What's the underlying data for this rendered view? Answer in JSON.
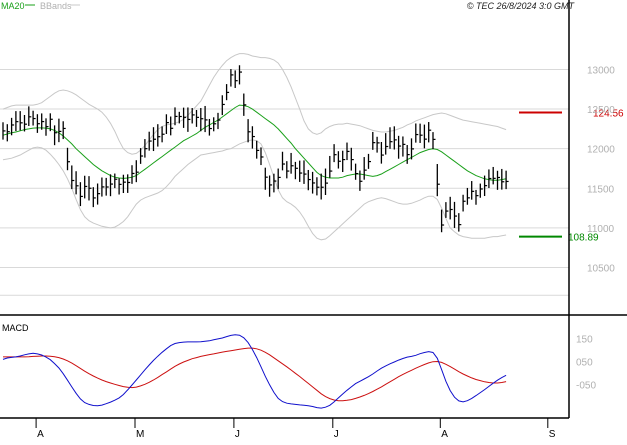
{
  "header": {
    "ma_label": "MA20",
    "bb_label": "BBands",
    "copyright": "© TEC 26/8/2024 3:0 GMT"
  },
  "colors": {
    "ma": "#1aa01a",
    "bands": "#c8c8c8",
    "price": "#000000",
    "grid": "#d9d9d9",
    "resistance": "#cc0000",
    "support": "#008800",
    "macd": "#1010cc",
    "signal": "#cc1010",
    "axis": "#000000",
    "ticklabel": "#b0b0b0"
  },
  "macd_panel": {
    "title": "MACD"
  },
  "levels": {
    "resistance": {
      "value": 12456,
      "label": "124.56"
    },
    "support": {
      "value": 10889,
      "label": "108.89"
    }
  },
  "chart_data": [
    {
      "type": "ohlc",
      "title": "",
      "indicators": [
        "MA20",
        "BBands"
      ],
      "y_ticks": [
        10500,
        11000,
        11500,
        12000,
        12500,
        13000
      ],
      "y_tick_labels": [
        "10500",
        "11000",
        "11500",
        "12000",
        "12500",
        "13000"
      ],
      "ylim": [
        9900,
        13700
      ],
      "x_tick_labels": [
        "A",
        "M",
        "J",
        "J",
        "A",
        "S"
      ],
      "x_tick_index": [
        7,
        30,
        53,
        76,
        101,
        126
      ],
      "grid": true,
      "close": [
        12224,
        12214,
        12299,
        12341,
        12326,
        12309,
        12402,
        12380,
        12315,
        12342,
        12278,
        12371,
        12201,
        12218,
        12255,
        11835,
        11598,
        11531,
        11397,
        11523,
        11500,
        11378,
        11432,
        11517,
        11516,
        11553,
        11614,
        11549,
        11577,
        11573,
        11687,
        11703,
        11907,
        12000,
        12096,
        12119,
        12151,
        12182,
        12329,
        12257,
        12407,
        12406,
        12396,
        12369,
        12426,
        12395,
        12378,
        12363,
        12254,
        12314,
        12361,
        12558,
        12710,
        12931,
        12858,
        12967,
        12553,
        12213,
        12153,
        11978,
        11895,
        11640,
        11542,
        11591,
        11637,
        11806,
        11717,
        11784,
        11752,
        11692,
        11679,
        11610,
        11567,
        11513,
        11513,
        11565,
        11717,
        11924,
        11841,
        11862,
        11965,
        11862,
        11685,
        11588,
        11729,
        11837,
        12076,
        12073,
        11919,
        12027,
        12088,
        12111,
        12033,
        12054,
        11925,
        11997,
        12178,
        12170,
        12120,
        12233,
        12117,
        11551,
        11036,
        11212,
        11232,
        11149,
        11041,
        11336,
        11379,
        11461,
        11407,
        11491,
        11533,
        11623,
        11625,
        11636,
        11582,
        11586
      ],
      "high": [
        12333,
        12309,
        12389,
        12474,
        12474,
        12425,
        12534,
        12479,
        12435,
        12445,
        12383,
        12446,
        12294,
        12379,
        12346,
        12011,
        11788,
        11715,
        11577,
        11658,
        11653,
        11514,
        11560,
        11636,
        11631,
        11676,
        11686,
        11626,
        11671,
        11676,
        11791,
        11854,
        12007,
        12121,
        12214,
        12271,
        12309,
        12281,
        12434,
        12406,
        12521,
        12465,
        12518,
        12520,
        12513,
        12488,
        12513,
        12539,
        12375,
        12396,
        12452,
        12674,
        12815,
        13005,
        12988,
        13053,
        12696,
        12373,
        12283,
        12100,
        12016,
        11760,
        11661,
        11684,
        11749,
        11961,
        11842,
        11946,
        11833,
        11849,
        11852,
        11731,
        11707,
        11639,
        11685,
        11749,
        11908,
        12057,
        11968,
        11974,
        12077,
        12011,
        11811,
        11724,
        11894,
        11934,
        12211,
        12150,
        12084,
        12196,
        12270,
        12282,
        12162,
        12154,
        12046,
        12130,
        12318,
        12316,
        12304,
        12336,
        12209,
        11806,
        11231,
        11325,
        11392,
        11328,
        11186,
        11418,
        11504,
        11591,
        11479,
        11559,
        11660,
        11738,
        11769,
        11721,
        11744,
        11722
      ],
      "low": [
        12114,
        12092,
        12169,
        12222,
        12230,
        12217,
        12286,
        12292,
        12199,
        12239,
        12163,
        12221,
        12044,
        12082,
        12121,
        11728,
        11490,
        11423,
        11275,
        11372,
        11346,
        11262,
        11294,
        11395,
        11407,
        11400,
        11502,
        11421,
        11440,
        11441,
        11556,
        11577,
        11808,
        11887,
        11975,
        11970,
        12026,
        12080,
        12185,
        12168,
        12296,
        12319,
        12262,
        12212,
        12318,
        12275,
        12220,
        12209,
        12165,
        12219,
        12247,
        12424,
        12612,
        12784,
        12766,
        12811,
        12414,
        12080,
        12001,
        11874,
        11793,
        11481,
        11393,
        11448,
        11489,
        11726,
        11625,
        11684,
        11614,
        11580,
        11555,
        11475,
        11433,
        11410,
        11358,
        11415,
        11632,
        11830,
        11749,
        11705,
        11856,
        11723,
        11607,
        11467,
        11608,
        11745,
        11985,
        11950,
        11811,
        11925,
        11998,
        11989,
        11873,
        11900,
        11808,
        11864,
        12076,
        12072,
        12004,
        12079,
        11994,
        11400,
        10945,
        11126,
        11107,
        10999,
        10953,
        11207,
        11292,
        11356,
        11292,
        11380,
        11402,
        11503,
        11549,
        11480,
        11483,
        11489
      ],
      "ma20": [
        12170,
        12185,
        12200,
        12210,
        12225,
        12240,
        12250,
        12260,
        12262,
        12262,
        12259,
        12250,
        12230,
        12200,
        12160,
        12110,
        12060,
        12000,
        11950,
        11900,
        11850,
        11800,
        11760,
        11720,
        11690,
        11660,
        11640,
        11630,
        11625,
        11630,
        11640,
        11660,
        11700,
        11740,
        11780,
        11820,
        11860,
        11900,
        11940,
        11980,
        12020,
        12060,
        12100,
        12130,
        12160,
        12190,
        12230,
        12270,
        12300,
        12330,
        12360,
        12400,
        12440,
        12480,
        12520,
        12550,
        12545,
        12530,
        12500,
        12460,
        12420,
        12380,
        12340,
        12300,
        12250,
        12190,
        12130,
        12070,
        12000,
        11940,
        11880,
        11820,
        11760,
        11700,
        11660,
        11640,
        11630,
        11630,
        11630,
        11640,
        11660,
        11670,
        11680,
        11680,
        11670,
        11660,
        11650,
        11660,
        11680,
        11710,
        11740,
        11770,
        11800,
        11830,
        11860,
        11890,
        11920,
        11950,
        11970,
        11990,
        12000,
        11990,
        11960,
        11920,
        11880,
        11840,
        11800,
        11760,
        11720,
        11690,
        11660,
        11640,
        11620,
        11610,
        11600,
        11600,
        11610,
        11620
      ],
      "bb_upper": [
        12500,
        12520,
        12540,
        12550,
        12550,
        12550,
        12550,
        12550,
        12560,
        12580,
        12620,
        12660,
        12700,
        12730,
        12740,
        12730,
        12710,
        12680,
        12640,
        12600,
        12560,
        12530,
        12500,
        12460,
        12400,
        12320,
        12220,
        12100,
        12000,
        11950,
        11930,
        11940,
        11980,
        12040,
        12110,
        12180,
        12240,
        12280,
        12300,
        12310,
        12320,
        12340,
        12370,
        12420,
        12480,
        12540,
        12600,
        12700,
        12800,
        12900,
        12980,
        13050,
        13110,
        13150,
        13180,
        13200,
        13200,
        13190,
        13170,
        13160,
        13150,
        13150,
        13140,
        13120,
        13080,
        13000,
        12900,
        12780,
        12640,
        12500,
        12350,
        12250,
        12200,
        12180,
        12200,
        12250,
        12280,
        12300,
        12310,
        12310,
        12320,
        12310,
        12300,
        12290,
        12270,
        12250,
        12230,
        12220,
        12210,
        12210,
        12220,
        12230,
        12250,
        12270,
        12300,
        12320,
        12350,
        12370,
        12390,
        12410,
        12430,
        12440,
        12450,
        12440,
        12420,
        12400,
        12380,
        12360,
        12350,
        12340,
        12330,
        12320,
        12310,
        12300,
        12290,
        12280,
        12260,
        12240
      ],
      "bb_lower": [
        11860,
        11870,
        11880,
        11900,
        11920,
        11950,
        11980,
        12010,
        12020,
        12010,
        11980,
        11930,
        11870,
        11800,
        11720,
        11620,
        11500,
        11360,
        11230,
        11140,
        11090,
        11060,
        11040,
        11020,
        11010,
        11000,
        11010,
        11040,
        11080,
        11140,
        11220,
        11300,
        11350,
        11380,
        11400,
        11420,
        11440,
        11470,
        11520,
        11580,
        11650,
        11700,
        11750,
        11800,
        11840,
        11880,
        11920,
        11930,
        11940,
        11950,
        11960,
        11970,
        11990,
        12000,
        12030,
        12060,
        12080,
        12100,
        12110,
        12100,
        12060,
        11950,
        11800,
        11640,
        11480,
        11380,
        11330,
        11300,
        11260,
        11200,
        11120,
        11020,
        10930,
        10870,
        10850,
        10860,
        10900,
        10950,
        11000,
        11050,
        11100,
        11150,
        11200,
        11250,
        11300,
        11330,
        11350,
        11370,
        11380,
        11370,
        11350,
        11330,
        11310,
        11300,
        11300,
        11310,
        11330,
        11350,
        11380,
        11400,
        11400,
        11360,
        11250,
        11120,
        11000,
        10950,
        10910,
        10890,
        10880,
        10870,
        10870,
        10870,
        10870,
        10880,
        10890,
        10890,
        10900,
        10910
      ]
    },
    {
      "type": "line",
      "title": "MACD",
      "y_ticks": [
        150,
        50,
        -50
      ],
      "y_tick_labels": [
        "150",
        "050",
        "-050"
      ],
      "ylim": [
        -195,
        230
      ],
      "x_tick_labels": [
        "A",
        "M",
        "J",
        "J",
        "A",
        "S"
      ],
      "grid": false,
      "series": [
        {
          "name": "MACD",
          "values": [
            59,
            65,
            68,
            70,
            74,
            79,
            83,
            86,
            83,
            78,
            69,
            58,
            41,
            22,
            -3,
            -31,
            -60,
            -88,
            -112,
            -128,
            -136,
            -141,
            -142,
            -139,
            -133,
            -126,
            -118,
            -108,
            -93,
            -73,
            -52,
            -30,
            -8,
            14,
            35,
            55,
            73,
            90,
            105,
            119,
            128,
            132,
            134,
            135,
            135,
            135,
            136,
            138,
            140,
            144,
            148,
            152,
            158,
            163,
            166,
            164,
            153,
            132,
            102,
            67,
            27,
            -14,
            -51,
            -84,
            -110,
            -124,
            -131,
            -134,
            -136,
            -138,
            -140,
            -142,
            -145,
            -150,
            -152,
            -148,
            -140,
            -125,
            -108,
            -91,
            -75,
            -60,
            -46,
            -36,
            -26,
            -16,
            -4,
            9,
            21,
            31,
            40,
            48,
            56,
            63,
            69,
            72,
            77,
            84,
            89,
            93,
            89,
            64,
            15,
            -36,
            -76,
            -105,
            -121,
            -125,
            -120,
            -110,
            -98,
            -85,
            -72,
            -58,
            -44,
            -31,
            -20,
            -10
          ]
        },
        {
          "name": "Signal",
          "values": [
            70,
            70,
            70,
            70,
            70,
            70,
            71,
            72,
            73,
            74,
            74,
            73,
            71,
            67,
            61,
            53,
            43,
            32,
            20,
            8,
            -3,
            -13,
            -22,
            -30,
            -37,
            -43,
            -49,
            -54,
            -59,
            -62,
            -63,
            -61,
            -56,
            -49,
            -40,
            -30,
            -19,
            -7,
            5,
            17,
            29,
            39,
            48,
            55,
            62,
            67,
            72,
            76,
            80,
            83,
            87,
            91,
            94,
            97,
            100,
            103,
            106,
            108,
            108,
            105,
            99,
            90,
            79,
            66,
            53,
            40,
            27,
            13,
            -1,
            -15,
            -30,
            -45,
            -60,
            -75,
            -90,
            -102,
            -111,
            -117,
            -120,
            -120,
            -118,
            -115,
            -110,
            -104,
            -97,
            -89,
            -80,
            -70,
            -60,
            -49,
            -38,
            -27,
            -16,
            -6,
            3,
            12,
            21,
            29,
            37,
            44,
            49,
            50,
            46,
            38,
            28,
            17,
            6,
            -4,
            -13,
            -21,
            -28,
            -33,
            -38,
            -41,
            -43,
            -43,
            -41,
            -37
          ]
        }
      ]
    }
  ]
}
